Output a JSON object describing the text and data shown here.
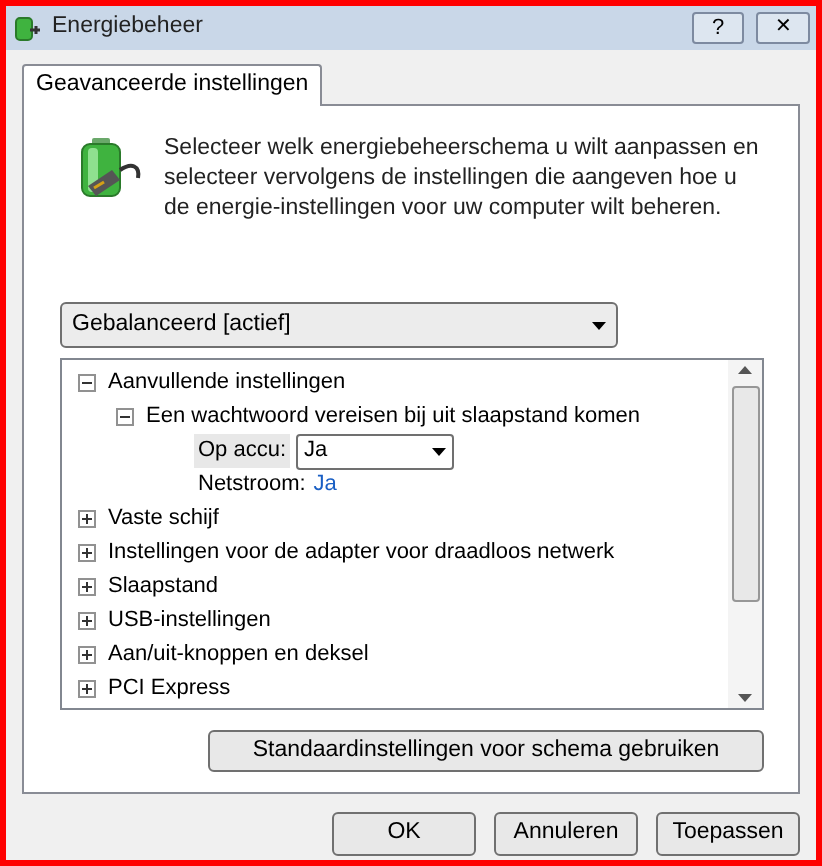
{
  "window": {
    "title": "Energiebeheer",
    "controls": [
      "?",
      "✕"
    ]
  },
  "tabs": [
    {
      "label": "Geavanceerde instellingen",
      "selected": true
    }
  ],
  "description": "Selecteer welk energiebeheerschema u wilt aanpassen en selecteer vervolgens de instellingen die aangeven hoe u de energie-instellingen voor uw computer wilt beheren.",
  "plan_dropdown": {
    "value": "Gebalanceerd [actief]"
  },
  "tree": [
    {
      "label": "Aanvullende instellingen",
      "expanded": true,
      "children": [
        {
          "label": "Een wachtwoord vereisen bij uit slaapstand komen",
          "expanded": true,
          "settings": [
            {
              "kind": "dropdown",
              "label": "Op accu:",
              "value": "Ja"
            },
            {
              "kind": "link",
              "label": "Netstroom:",
              "value": "Ja"
            }
          ]
        }
      ]
    },
    {
      "label": "Vaste schijf",
      "expanded": false
    },
    {
      "label": "Instellingen voor de adapter voor draadloos netwerk",
      "expanded": false
    },
    {
      "label": "Slaapstand",
      "expanded": false
    },
    {
      "label": "USB-instellingen",
      "expanded": false
    },
    {
      "label": "Aan/uit-knoppen en deksel",
      "expanded": false
    },
    {
      "label": "PCI Express",
      "expanded": false
    }
  ],
  "restore_button": "Standaardinstellingen voor schema gebruiken",
  "buttons": [
    "OK",
    "Annuleren",
    "Toepassen"
  ]
}
